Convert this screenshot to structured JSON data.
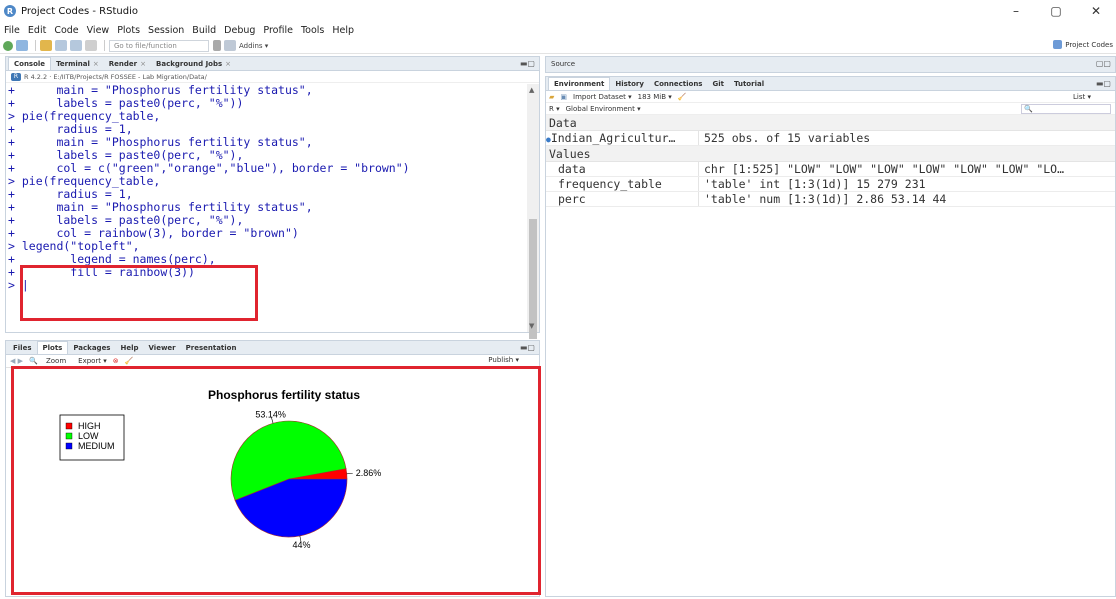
{
  "window": {
    "title": "Project Codes - RStudio",
    "minimize": "–",
    "maximize": "▢",
    "close": "✕"
  },
  "menu": [
    "File",
    "Edit",
    "Code",
    "View",
    "Plots",
    "Session",
    "Build",
    "Debug",
    "Profile",
    "Tools",
    "Help"
  ],
  "toolbar": {
    "goto_placeholder": "Go to file/function",
    "addins": "Addins ▾",
    "project": "Project Codes"
  },
  "console_pane": {
    "tabs": [
      {
        "label": "Console"
      },
      {
        "label": "Terminal",
        "close": "×"
      },
      {
        "label": "Render",
        "close": "×"
      },
      {
        "label": "Background Jobs",
        "close": "×"
      }
    ],
    "path": "R 4.2.2 · E:/IITB/Projects/R FOSSEE - Lab Migration/Data/",
    "lines": [
      "+      main = \"Phosphorus fertility status\",",
      "+      labels = paste0(perc, \"%\"))",
      "> pie(frequency_table,",
      "+      radius = 1,",
      "+      main = \"Phosphorus fertility status\",",
      "+      labels = paste0(perc, \"%\"),",
      "+      col = c(\"green\",\"orange\",\"blue\"), border = \"brown\")",
      "> pie(frequency_table,",
      "+      radius = 1,",
      "+      main = \"Phosphorus fertility status\",",
      "+      labels = paste0(perc, \"%\"),",
      "+      col = rainbow(3), border = \"brown\")",
      "> legend(\"topleft\",",
      "+        legend = names(perc),",
      "+        fill = rainbow(3))",
      "> |"
    ]
  },
  "plots_pane": {
    "tabs": [
      "Files",
      "Plots",
      "Packages",
      "Help",
      "Viewer",
      "Presentation"
    ],
    "toolbar": {
      "zoom": "Zoom",
      "export": "Export ▾",
      "publish": "Publish ▾"
    }
  },
  "source_pane": {
    "label": "Source"
  },
  "env_pane": {
    "tabs": [
      "Environment",
      "History",
      "Connections",
      "Git",
      "Tutorial"
    ],
    "toolbar": {
      "import": "Import Dataset ▾",
      "memory": "183 MiB ▾",
      "r": "R ▾",
      "global": "Global Environment ▾",
      "list": "List ▾"
    },
    "sections": {
      "data": "Data",
      "values": "Values"
    },
    "data_rows": [
      {
        "name": "Indian_Agricultur…",
        "value": "525 obs. of 15 variables"
      }
    ],
    "value_rows": [
      {
        "name": "data",
        "value": "chr [1:525] \"LOW\" \"LOW\" \"LOW\" \"LOW\" \"LOW\" \"LOW\" \"LO…"
      },
      {
        "name": "frequency_table",
        "value": "'table' int [1:3(1d)] 15 279 231"
      },
      {
        "name": "perc",
        "value": "'table' num [1:3(1d)] 2.86 53.14 44"
      }
    ]
  },
  "chart_data": {
    "type": "pie",
    "title": "Phosphorus fertility status",
    "categories": [
      "HIGH",
      "LOW",
      "MEDIUM"
    ],
    "values": [
      2.86,
      53.14,
      44
    ],
    "labels": [
      "2.86%",
      "53.14%",
      "44%"
    ],
    "colors": [
      "#ff0000",
      "#00ff00",
      "#0000ff"
    ],
    "border_color": "#a52a2a",
    "legend": {
      "placement": "top-left",
      "entries": [
        "HIGH",
        "LOW",
        "MEDIUM"
      ]
    }
  }
}
